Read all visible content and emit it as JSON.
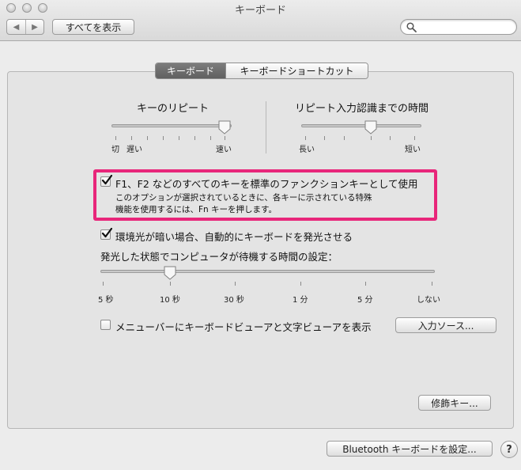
{
  "window": {
    "title": "キーボード"
  },
  "toolbar": {
    "back_glyph": "◀",
    "forward_glyph": "▶",
    "show_all_label": "すべてを表示",
    "search_placeholder": "",
    "search_value": ""
  },
  "tabs": [
    {
      "label": "キーボード",
      "active": true
    },
    {
      "label": "キーボードショートカット",
      "active": false
    }
  ],
  "key_repeat": {
    "title": "キーのリピート",
    "labels": [
      "切",
      "遅い",
      "速い"
    ],
    "value_fraction": 1.0
  },
  "delay_until_repeat": {
    "title": "リピート入力認識までの時間",
    "labels": [
      "長い",
      "短い"
    ],
    "value_fraction": 0.6
  },
  "fn_keys": {
    "checked": true,
    "label": "F1、F2 などのすべてのキーを標準のファンクションキーとして使用",
    "description_line1": "このオプションが選択されているときに、各キーに示されている特殊",
    "description_line2": "機能を使用するには、Fn キーを押します。"
  },
  "backlight": {
    "checked": true,
    "label": "環境光が暗い場合、自動的にキーボードを発光させる",
    "idle_title": "発光した状態でコンピュータが待機する時間の設定：",
    "idle_labels": [
      "5 秒",
      "10 秒",
      "30 秒",
      "1 分",
      "5 分",
      "しない"
    ],
    "idle_value_fraction": 0.2
  },
  "viewer": {
    "checked": false,
    "label": "メニューバーにキーボードビューアと文字ビューアを表示",
    "input_sources_button": "入力ソース..."
  },
  "modifier_keys_button": "修飾キー...",
  "bluetooth_button": "Bluetooth キーボードを設定...",
  "help_glyph": "?",
  "colors": {
    "highlight": "#e8267a",
    "active_tab": "#6a6a6a"
  },
  "icons": [
    "search-icon",
    "checkmark-icon",
    "slider-thumb-icon",
    "help-icon"
  ]
}
